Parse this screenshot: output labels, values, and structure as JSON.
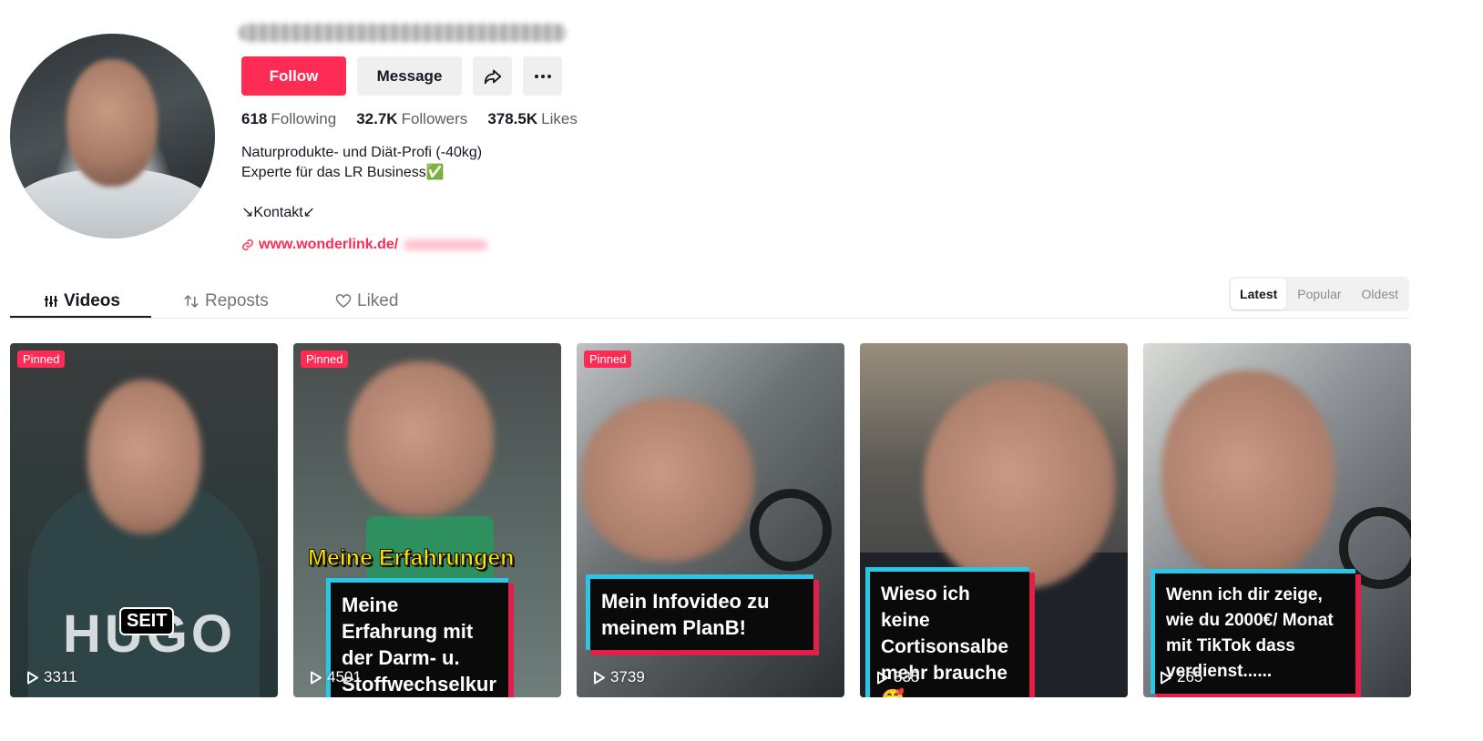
{
  "profile": {
    "follow_label": "Follow",
    "message_label": "Message",
    "stats": [
      {
        "value": "618",
        "label": "Following"
      },
      {
        "value": "32.7K",
        "label": "Followers"
      },
      {
        "value": "378.5K",
        "label": "Likes"
      }
    ],
    "bio": "Naturprodukte- und Diät-Profi (-40kg)\nExperte für das LR Business✅\n\n↘Kontakt↙",
    "link": "www.wonderlink.de/"
  },
  "tabs": {
    "videos": "Videos",
    "reposts": "Reposts",
    "liked": "Liked"
  },
  "sort": [
    "Latest",
    "Popular",
    "Oldest"
  ],
  "videos": [
    {
      "pinned": "Pinned",
      "views": "3311",
      "overlay_text": "SEIT",
      "shirt_text": "HUGO"
    },
    {
      "pinned": "Pinned",
      "views": "4501",
      "yellow_text": "Meine Erfahrungen",
      "caption": "Meine Erfahrung mit der Darm- u. Stoffwechselkur"
    },
    {
      "pinned": "Pinned",
      "views": "3739",
      "caption": "Mein Infovideo zu meinem PlanB!"
    },
    {
      "views": "335",
      "caption": "Wieso ich keine Cortisonsalbe mehr brauche🥰"
    },
    {
      "views": "265",
      "caption": "Wenn ich dir zeige, wie du 2000€/ Monat mit TikTok dass verdienst......"
    }
  ],
  "colors": {
    "accent": "#fe2c55",
    "caption_border": "#2bc6e5",
    "caption_shadow": "#e01f4b"
  }
}
